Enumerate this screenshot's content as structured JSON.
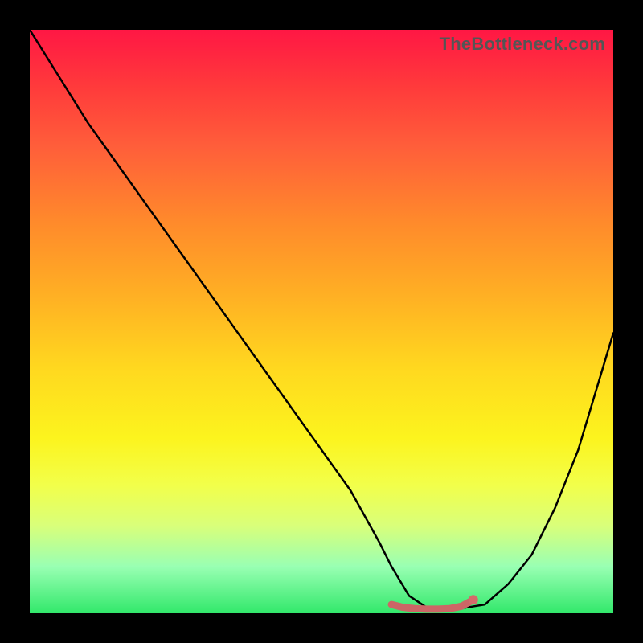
{
  "watermark": "TheBottleneck.com",
  "chart_data": {
    "type": "line",
    "title": "",
    "xlabel": "",
    "ylabel": "",
    "xlim": [
      0,
      100
    ],
    "ylim": [
      0,
      100
    ],
    "series": [
      {
        "name": "bottleneck-curve",
        "x": [
          0,
          5,
          10,
          15,
          20,
          25,
          30,
          35,
          40,
          45,
          50,
          55,
          60,
          62,
          65,
          68,
          70,
          72,
          75,
          78,
          82,
          86,
          90,
          94,
          100
        ],
        "values": [
          100,
          92,
          84,
          77,
          70,
          63,
          56,
          49,
          42,
          35,
          28,
          21,
          12,
          8,
          3,
          1,
          0.5,
          0.5,
          1,
          1.5,
          5,
          10,
          18,
          28,
          48
        ]
      },
      {
        "name": "bottleneck-marker",
        "x": [
          62,
          64,
          66,
          68,
          70,
          72,
          74,
          76
        ],
        "values": [
          1.5,
          1.0,
          0.8,
          0.7,
          0.7,
          0.8,
          1.2,
          2.3
        ]
      }
    ],
    "colors": {
      "curve": "#000000",
      "marker": "#cc6666",
      "marker_endpoint": "#d46a6a",
      "background_top": "#ff1744",
      "background_bottom": "#32e86b"
    }
  }
}
